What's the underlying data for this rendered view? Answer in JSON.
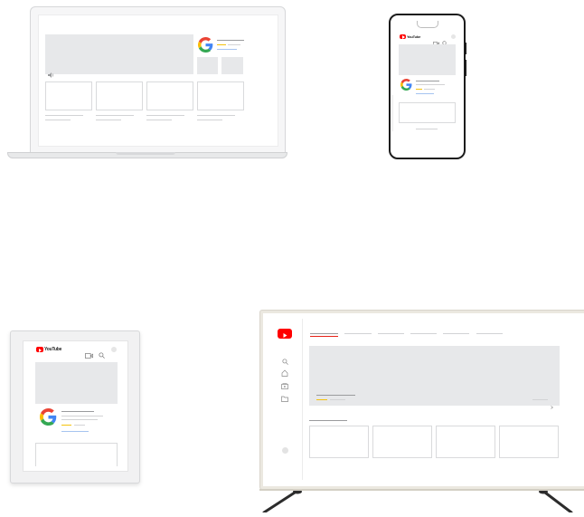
{
  "brand": {
    "youtube_wordmark": "YouTube",
    "colors": {
      "youtube_red": "#ff0000",
      "google_blue": "#4285f4",
      "google_red": "#ea4335",
      "google_yellow": "#fbbc05",
      "google_green": "#34a853",
      "placeholder_gray": "#e7e8ea"
    }
  },
  "devices": [
    "laptop",
    "phone",
    "tablet",
    "tv"
  ],
  "icons": {
    "video": "video-camera-icon",
    "search": "search-icon",
    "home": "home-icon",
    "subscriptions": "subscriptions-icon",
    "library": "folder-icon",
    "mute": "speaker-icon",
    "avatar": "avatar-icon"
  }
}
